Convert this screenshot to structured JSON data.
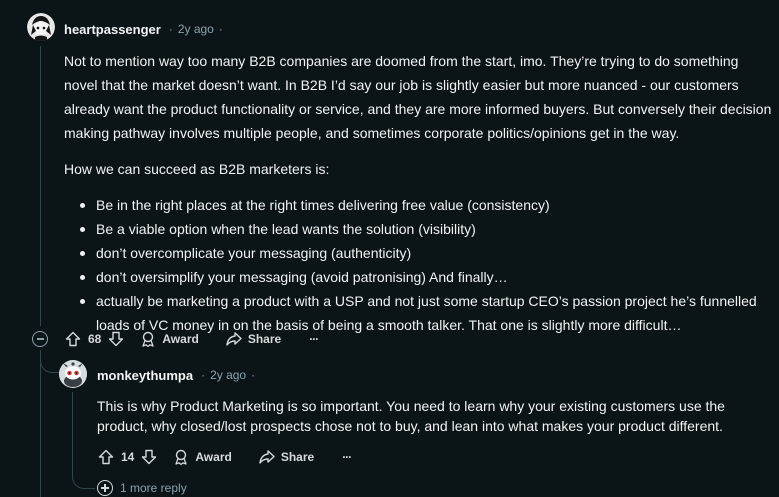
{
  "comment": {
    "username": "heartpassenger",
    "time": "2y ago",
    "separator": "·",
    "paragraph1": "Not to mention way too many B2B companies are doomed from the start, imo. They’re trying to do something novel that the market doesn’t want. In B2B I’d say our job is slightly easier but more nuanced - our customers already want the product functionality or service, and they are more informed buyers. But conversely their decision making pathway involves multiple people, and sometimes corporate politics/opinions get in the way.",
    "paragraph2": "How we can succeed as B2B marketers is:",
    "bullets": [
      "Be in the right places at the right times delivering free value (consistency)",
      "Be a viable option when the lead wants the solution (visibility)",
      "don’t overcomplicate your messaging (authenticity)",
      "don’t oversimplify your messaging (avoid patronising) And finally…",
      "actually be marketing a product with a USP and not just some startup CEO’s passion project he’s funnelled loads of VC money in on the basis of being a smooth talker. That one is slightly more difficult…"
    ],
    "votes": "68",
    "award_label": "Award",
    "share_label": "Share",
    "more_label": "···"
  },
  "reply": {
    "username": "monkeythumpa",
    "time": "2y ago",
    "separator": "·",
    "text": "This is why Product Marketing is so important. You need to learn why your existing customers use the product, why closed/lost prospects chose not to buy, and lean into what makes your product different.",
    "votes": "14",
    "award_label": "Award",
    "share_label": "Share",
    "more_label": "···",
    "more_replies": "1 more reply"
  },
  "colors": {
    "background": "#0b1416",
    "text": "#f2f4f5",
    "meta": "#8ba2ad",
    "thread_line": "#33464c"
  },
  "icons": [
    "upvote-icon",
    "downvote-icon",
    "award-icon",
    "share-icon",
    "collapse-icon",
    "plus-circle-icon"
  ]
}
